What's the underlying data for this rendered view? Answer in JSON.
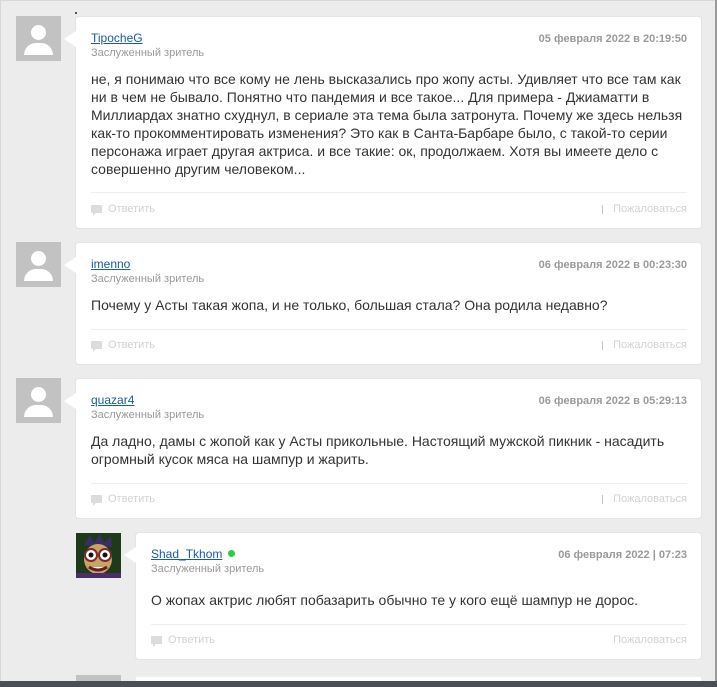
{
  "comments": [
    {
      "author": "TipocheG",
      "rank": "Заслуженный зритель",
      "date": "05 февраля 2022 в 20:19:50",
      "text_lines": [
        "не, я понимаю что все кому не лень высказались про жопу асты. Удивляет что все там как",
        "ни в чем не бывало. Понятно что пандемия и все такое... Для примера - Джиаматти в",
        "Миллиардах знатно схуднул, в сериале эта тема была затронута. Почему же здесь нельзя",
        "как-то прокомментировать изменения? Это как в Санта-Барбаре было, с такой-то серии",
        "персонажа играет другая актриса. и все такие: ок, продолжаем. Хотя вы имеете дело с",
        "совершенно другим человеком..."
      ],
      "reply_label": "Ответить",
      "complain_label": "Пожаловаться",
      "avatar_icon": "user-silhouette-icon"
    },
    {
      "author": "imenno",
      "rank": "Заслуженный зритель",
      "date": "06 февраля 2022 в 00:23:30",
      "text_lines": [
        "Почему у Асты такая жопа, и не только, большая стала? Она родила недавно?"
      ],
      "reply_label": "Ответить",
      "complain_label": "Пожаловаться",
      "avatar_icon": "user-silhouette-icon"
    },
    {
      "author": "quazar4",
      "rank": "Заслуженный зритель",
      "date": "06 февраля 2022 в 05:29:13",
      "text_lines": [
        "Да ладно, дамы с жопой как у Асты прикольные. Настоящий мужской пикник - насадить",
        "огромный кусок мяса на шампур и жарить."
      ],
      "reply_label": "Ответить",
      "complain_label": "Пожаловаться",
      "avatar_icon": "user-silhouette-icon"
    },
    {
      "author": "Shad_Tkhom",
      "rank": "Заслуженный зритель",
      "date": "06 февраля 2022 | 07:23",
      "online": true,
      "text_lines": [
        "О жопах актрис любят побазарить обычно те у кого ещё шампур не дорос."
      ],
      "reply_label": "Ответить",
      "complain_label": "Пожаловаться",
      "avatar_icon": "cartoon-avatar-icon"
    }
  ],
  "colors": {
    "link": "#1a5aa6",
    "online": "#2ecc40",
    "background": "#ececec"
  }
}
